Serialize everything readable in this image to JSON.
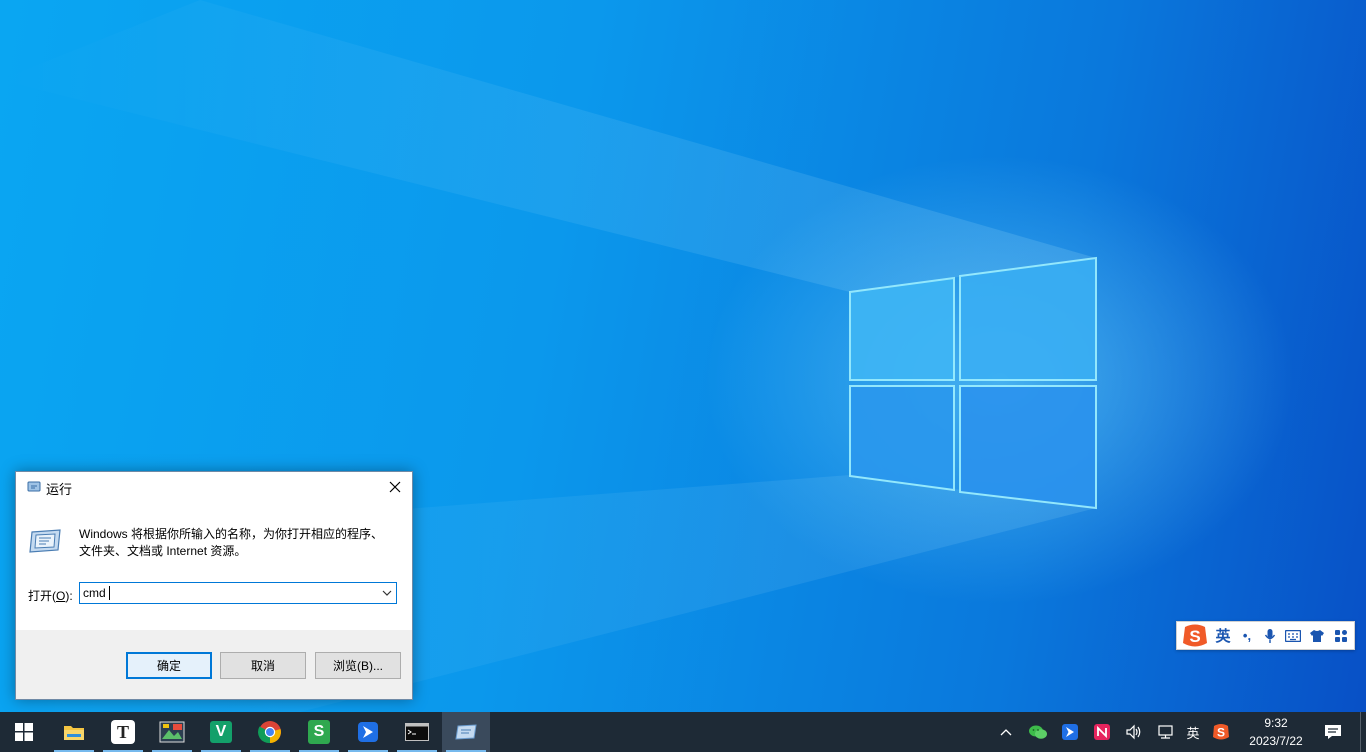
{
  "dialog": {
    "title": "运行",
    "description_line1": "Windows 将根据你所输入的名称，为你打开相应的程序、",
    "description_line2": "文件夹、文档或 Internet 资源。",
    "open_label_prefix": "打开(",
    "open_label_key": "O",
    "open_label_suffix": "):",
    "input_value": "cmd",
    "ok_label": "确定",
    "cancel_label": "取消",
    "browse_label": "浏览(B)..."
  },
  "ime": {
    "lang": "英",
    "punct": "•,"
  },
  "taskbar": {
    "apps": [
      {
        "name": "start",
        "icon": "windows-logo-icon"
      },
      {
        "name": "file-explorer",
        "icon": "folder-icon"
      },
      {
        "name": "typora",
        "icon": "t-letter-icon",
        "letter": "T"
      },
      {
        "name": "photo-app",
        "icon": "photo-icon"
      },
      {
        "name": "vim",
        "icon": "v-letter-icon",
        "letter": "V"
      },
      {
        "name": "chrome",
        "icon": "chrome-icon"
      },
      {
        "name": "wps-sheet",
        "icon": "s-letter-icon",
        "letter": "S"
      },
      {
        "name": "feishu",
        "icon": "feishu-icon"
      },
      {
        "name": "terminal",
        "icon": "terminal-icon"
      },
      {
        "name": "run",
        "icon": "run-icon"
      }
    ],
    "tray_lang": "英",
    "time": "9:32",
    "date": "2023/7/22"
  },
  "colors": {
    "accent": "#0078d7",
    "taskbar": "#1e2a36",
    "ime_blue": "#1a55b0",
    "sogou_orange": "#f05a28"
  }
}
